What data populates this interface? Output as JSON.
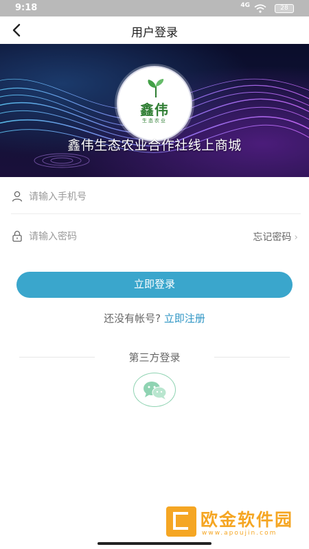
{
  "status_bar": {
    "time": "9:18",
    "network": "4G",
    "battery": "28"
  },
  "navbar": {
    "title": "用户登录",
    "back_icon": "chevron-left-icon"
  },
  "banner": {
    "logo_brand": "鑫伟",
    "logo_sub": "生态农业",
    "shop_name": "鑫伟生态农业合作社线上商城"
  },
  "form": {
    "phone_placeholder": "请输入手机号",
    "phone_value": "",
    "password_placeholder": "请输入密码",
    "password_value": "",
    "forgot_label": "忘记密码",
    "login_label": "立即登录"
  },
  "register": {
    "prompt": "还没有帐号?",
    "link": "立即注册"
  },
  "third_party": {
    "label": "第三方登录",
    "icon": "wechat-icon"
  },
  "watermark": {
    "name": "欧金软件园",
    "url": "www.apoujin.com"
  },
  "colors": {
    "primary": "#3aa6cc",
    "link": "#2e95c4",
    "wechat": "#8fd3b2",
    "watermark": "#f5a623"
  }
}
